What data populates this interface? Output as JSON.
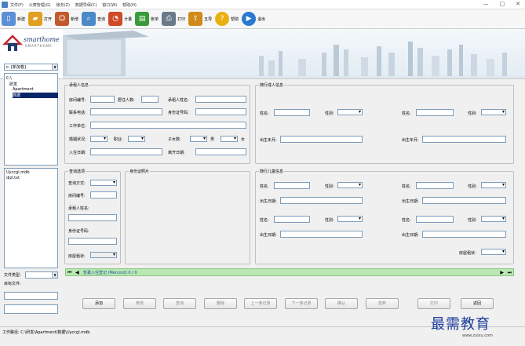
{
  "titlebar": {
    "menu": [
      "文件(F)",
      "公寓管理(G)",
      "账务(Z)",
      "数据导保(C)",
      "窗口(W)",
      "帮助(H)"
    ],
    "win_min": "—",
    "win_max": "□",
    "win_close": "✕"
  },
  "toolbar": {
    "items": [
      {
        "label": "新建",
        "icon": "new-file-icon",
        "color": "#5b8fd6"
      },
      {
        "label": "打开",
        "icon": "open-folder-icon",
        "color": "#e0a020"
      },
      {
        "label": "新增",
        "icon": "add-people-icon",
        "color": "#c05a2a"
      },
      {
        "label": "查询",
        "icon": "search-icon",
        "color": "#4a8ac8"
      },
      {
        "label": "计量",
        "icon": "pie-chart-icon",
        "color": "#d04a2a"
      },
      {
        "label": "账单",
        "icon": "bill-icon",
        "color": "#3a9a3a"
      },
      {
        "label": "打印",
        "icon": "printer-icon",
        "color": "#6a7a8a"
      },
      {
        "label": "五导",
        "icon": "export-icon",
        "color": "#d08a1a"
      },
      {
        "label": "帮助",
        "icon": "help-icon",
        "color": "#e8b010"
      },
      {
        "label": "退出",
        "icon": "exit-icon",
        "color": "#2a78d0"
      }
    ]
  },
  "banner": {
    "logo_main": "smarthome",
    "logo_sub": "SMARTHOME"
  },
  "left": {
    "drive": "c: [新加卷]",
    "tree": [
      "C:\\",
      "研发",
      "Apartment",
      "数据"
    ],
    "files": [
      "Uyccgl.mdb",
      "djzl.txt"
    ],
    "filetype_label": "文件类型:",
    "target_label": "目标文件:"
  },
  "tenant": {
    "title": "承租人信息",
    "room_no": "房间编号:",
    "persons": "居住人数:",
    "name": "承租人姓名:",
    "phone": "联系电话:",
    "id_no": "身份证号码:",
    "work": "工作单位:",
    "marital": "婚姻状况:",
    "job": "职业:",
    "children": "子女数:",
    "male": "男",
    "female": "女",
    "checkin": "入住日期:",
    "checkout": "离开日期:"
  },
  "adult": {
    "title": "随行成人信息",
    "name_l": "姓名:",
    "sex_l": "性别:",
    "name_r": "姓名:",
    "sex_r": "性别:",
    "birth_l": "出生年月:",
    "birth_r": "出生年月:"
  },
  "query": {
    "title": "查询选项",
    "mode": "查询方式:",
    "room_no": "房间编号:",
    "name": "承租人姓名:",
    "id_no": "身份证号码:",
    "rent_status": "房屋租状:"
  },
  "idphoto": {
    "title": "身份证照片"
  },
  "child": {
    "title": "随行儿童信息",
    "name": "姓名:",
    "sex": "性别:",
    "birth": "出生日期:",
    "rent_status": "房屋租状:"
  },
  "nav": {
    "text": "暂幕入住登记 (Mercord) 0 / 0"
  },
  "buttons": [
    "添加",
    "修改",
    "查询",
    "删除",
    "上一条记录",
    "下一条记录",
    "确认",
    "放弃",
    "打印",
    "返回"
  ],
  "status": {
    "path": "工作路径: C:\\研发\\Apartment\\数据\\Uyccgl.mdb"
  },
  "watermark": {
    "text": "最需教育",
    "sub": "www.zuixu.com"
  }
}
